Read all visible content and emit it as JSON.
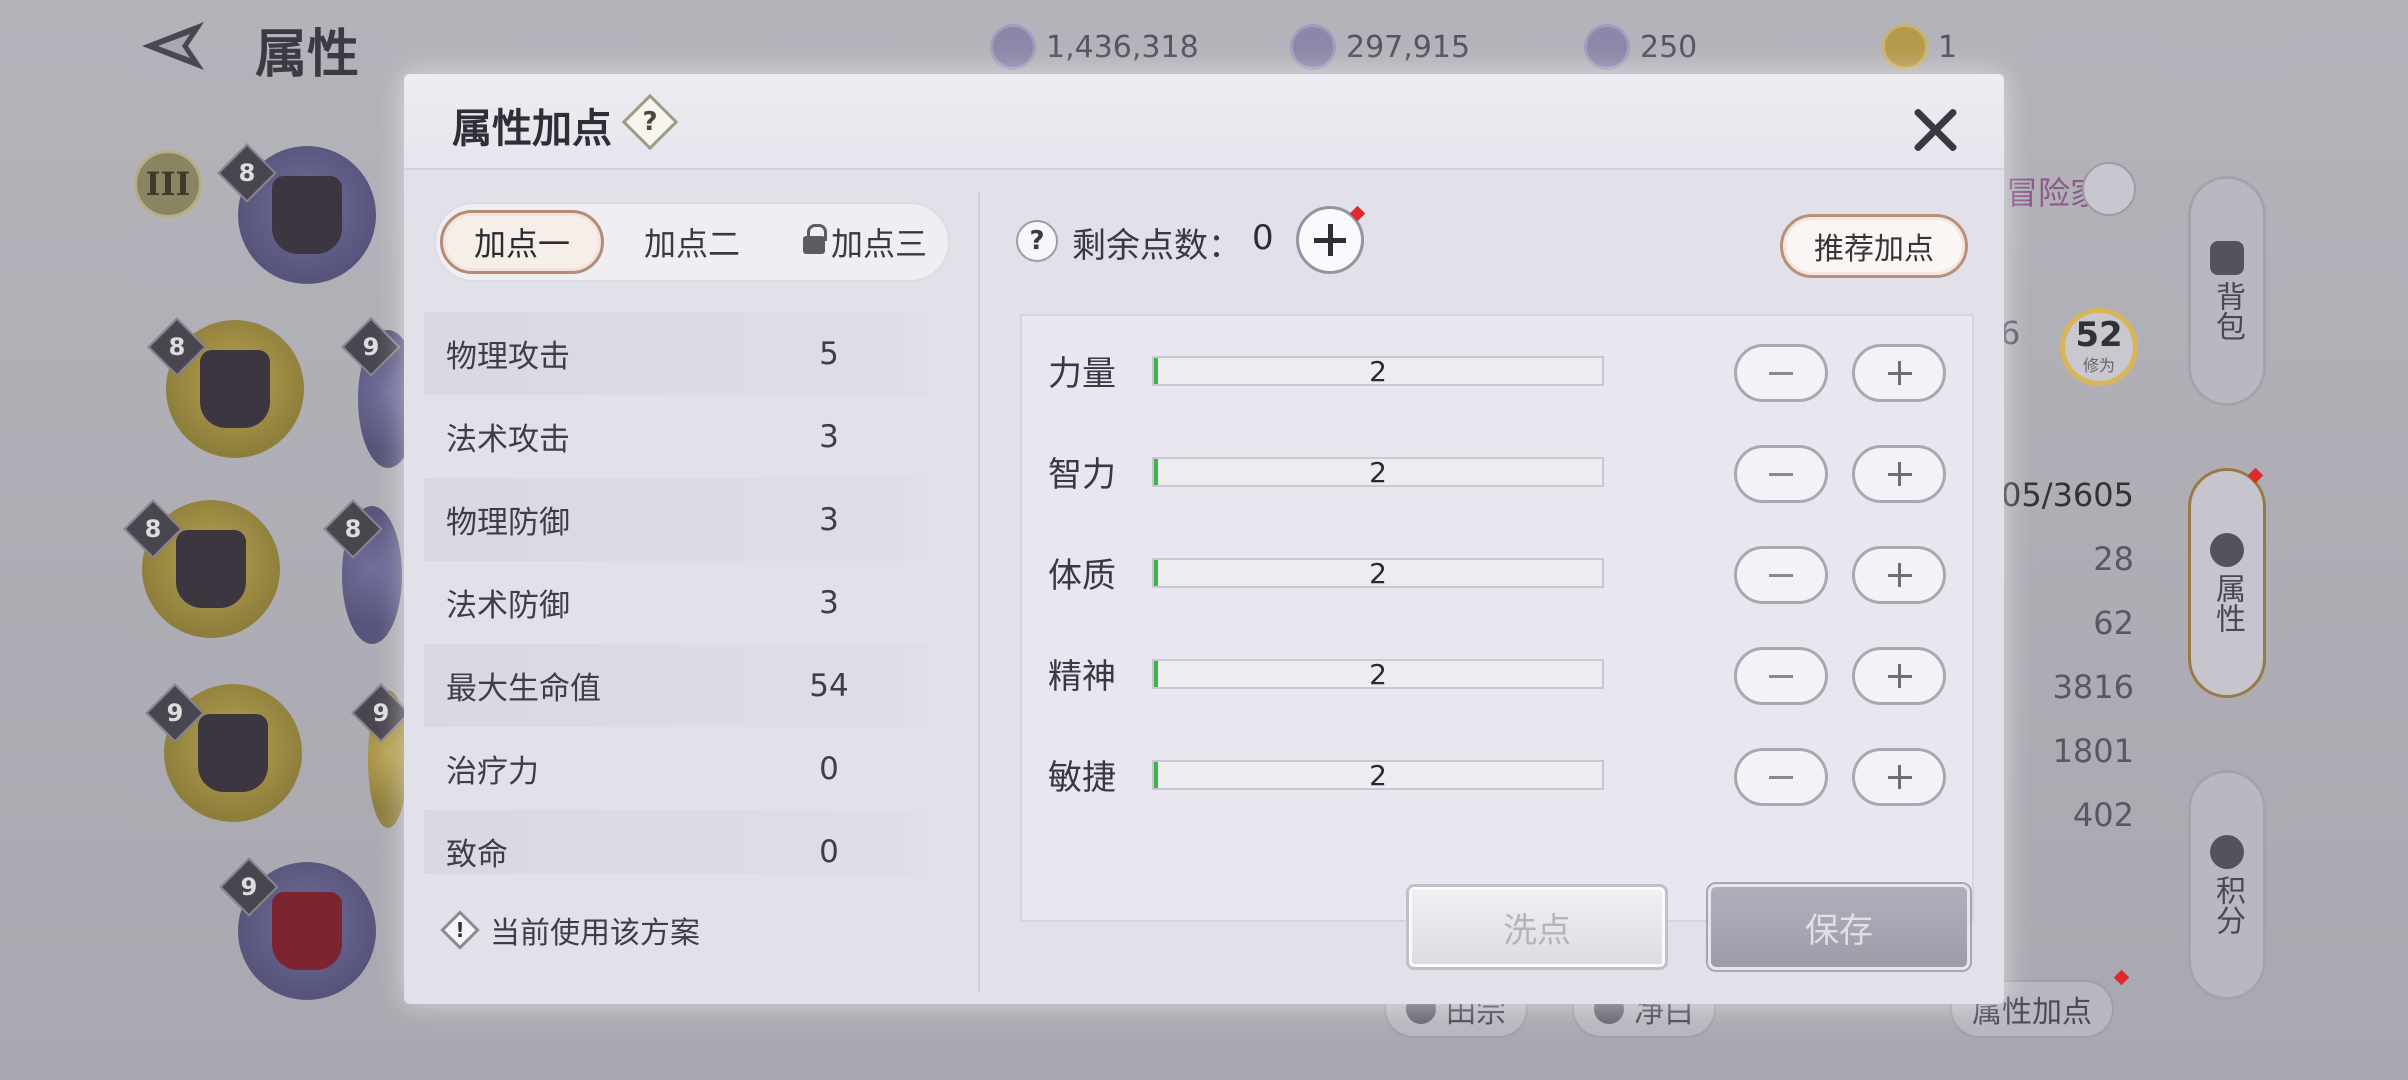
{
  "background": {
    "title": "属性",
    "currencies": [
      {
        "icon": "crystal-icon",
        "value": "1,436,318"
      },
      {
        "icon": "coin-icon",
        "value": "297,915"
      },
      {
        "icon": "gem-icon",
        "value": "250"
      },
      {
        "icon": "medal-icon",
        "value": "1"
      }
    ],
    "equip_levels": [
      "8",
      "8",
      "9",
      "8",
      "8",
      "9",
      "9",
      "9"
    ],
    "rank_roman": "III",
    "adventurer_label": "冒险家",
    "level": {
      "value": "52",
      "label": "修为"
    },
    "stats_right": [
      "05/3605",
      "28",
      "62",
      "3816",
      "1801",
      "402"
    ],
    "side_tabs": [
      "背包",
      "属性",
      "积分"
    ],
    "bottom_buttons": [
      "田宗",
      "净白",
      "属性加点"
    ],
    "hidden_number": "6"
  },
  "modal": {
    "title": "属性加点",
    "plan_tabs": [
      "加点一",
      "加点二",
      "加点三"
    ],
    "active_plan": "加点一",
    "stats": [
      {
        "name": "物理攻击",
        "value": "5"
      },
      {
        "name": "法术攻击",
        "value": "3"
      },
      {
        "name": "物理防御",
        "value": "3"
      },
      {
        "name": "法术防御",
        "value": "3"
      },
      {
        "name": "最大生命值",
        "value": "54"
      },
      {
        "name": "治疗力",
        "value": "0"
      },
      {
        "name": "致命",
        "value": "0"
      }
    ],
    "current_plan_note": "当前使用该方案",
    "remaining_label": "剩余点数：",
    "remaining_value": "0",
    "recommend_label": "推荐加点",
    "attributes": [
      {
        "name": "力量",
        "value": "2",
        "fill": 0.01
      },
      {
        "name": "智力",
        "value": "2",
        "fill": 0.01
      },
      {
        "name": "体质",
        "value": "2",
        "fill": 0.01
      },
      {
        "name": "精神",
        "value": "2",
        "fill": 0.01
      },
      {
        "name": "敏捷",
        "value": "2",
        "fill": 0.01
      }
    ],
    "reset_label": "洗点",
    "save_label": "保存"
  }
}
